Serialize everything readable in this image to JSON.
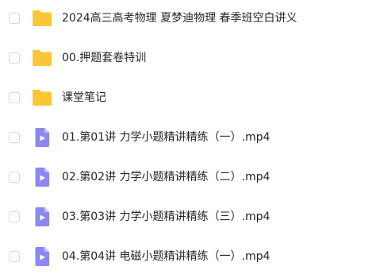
{
  "file_list": {
    "items": [
      {
        "type": "folder",
        "icon": "folder-icon",
        "name": "2024高三高考物理 夏梦迪物理 春季班空白讲义"
      },
      {
        "type": "folder",
        "icon": "folder-icon",
        "name": "00.押题套卷特训"
      },
      {
        "type": "folder",
        "icon": "folder-icon",
        "name": "课堂笔记"
      },
      {
        "type": "video",
        "icon": "video-file-icon",
        "name": "01.第01讲 力学小题精讲精练（一）.mp4"
      },
      {
        "type": "video",
        "icon": "video-file-icon",
        "name": "02.第02讲 力学小题精讲精练（二）.mp4"
      },
      {
        "type": "video",
        "icon": "video-file-icon",
        "name": "03.第03讲 力学小题精讲精练（三）.mp4"
      },
      {
        "type": "video",
        "icon": "video-file-icon",
        "name": "04.第04讲 电磁小题精讲精练（一）.mp4"
      }
    ]
  },
  "colors": {
    "folder": "#f9c735",
    "video_file": "#8b88f6",
    "video_file_fold": "#c3c0fb",
    "text": "#25262b",
    "checkbox_border": "#d4d7de"
  }
}
